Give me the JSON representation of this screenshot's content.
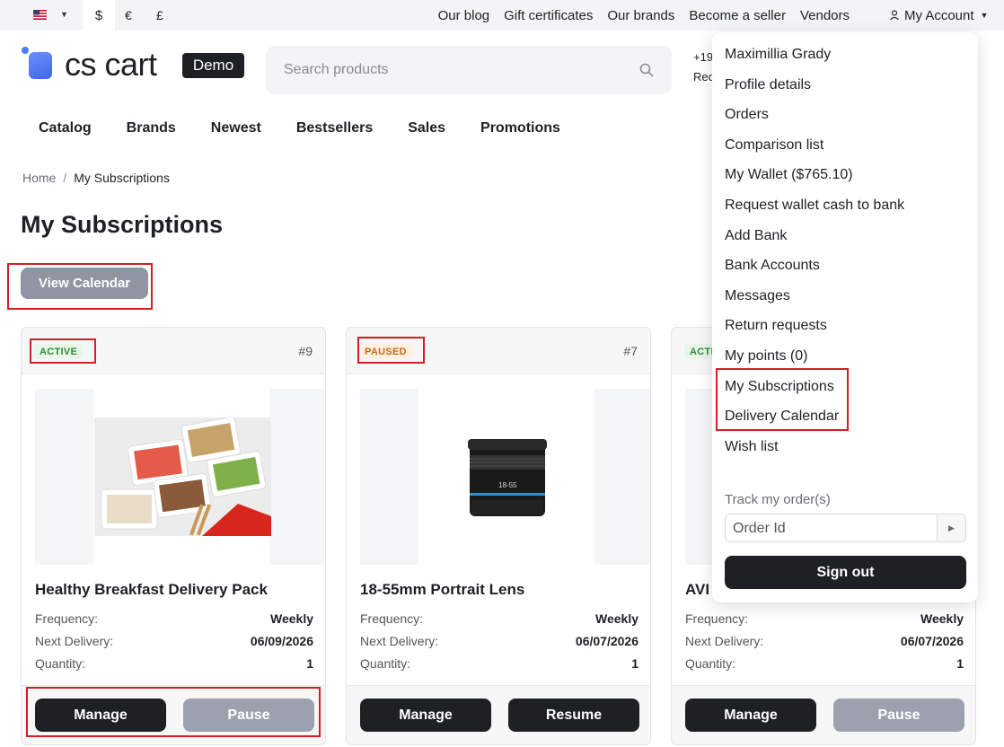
{
  "topbar": {
    "language_flag": "us-flag-icon",
    "currencies": [
      "$",
      "€",
      "£"
    ],
    "links": [
      "Our blog",
      "Gift certificates",
      "Our brands",
      "Become a seller",
      "Vendors"
    ],
    "my_account": "My Account"
  },
  "header": {
    "logo_text": "cs cart",
    "demo_badge": "Demo",
    "search_placeholder": "Search products",
    "phone_partial": "+19",
    "request_partial": "Rec"
  },
  "nav": [
    "Catalog",
    "Brands",
    "Newest",
    "Bestsellers",
    "Sales",
    "Promotions"
  ],
  "breadcrumb": {
    "home": "Home",
    "separator": "/",
    "current": "My Subscriptions"
  },
  "page_title": "My Subscriptions",
  "view_calendar_label": "View Calendar",
  "cards": [
    {
      "status": "ACTIVE",
      "number": "#9",
      "name": "Healthy Breakfast Delivery Pack",
      "frequency_label": "Frequency:",
      "frequency": "Weekly",
      "next_label": "Next Delivery:",
      "next": "06/09/2026",
      "qty_label": "Quantity:",
      "qty": "1",
      "primary": "Manage",
      "secondary": "Pause"
    },
    {
      "status": "PAUSED",
      "number": "#7",
      "name": "18-55mm Portrait Lens",
      "frequency_label": "Frequency:",
      "frequency": "Weekly",
      "next_label": "Next Delivery:",
      "next": "06/07/2026",
      "qty_label": "Quantity:",
      "qty": "1",
      "primary": "Manage",
      "secondary": "Resume"
    },
    {
      "status": "ACTIVE",
      "number": "",
      "name": "AVI",
      "frequency_label": "Frequency:",
      "frequency": "Weekly",
      "next_label": "Next Delivery:",
      "next": "06/07/2026",
      "qty_label": "Quantity:",
      "qty": "1",
      "primary": "Manage",
      "secondary": "Pause"
    }
  ],
  "account_menu": {
    "items": [
      "Maximillia Grady",
      "Profile details",
      "Orders",
      "Comparison list",
      "My Wallet ($765.10)",
      "Request wallet cash to bank",
      "Add Bank",
      "Bank Accounts",
      "Messages",
      "Return requests",
      "My points (0)",
      "My Subscriptions",
      "Delivery Calendar",
      "Wish list"
    ],
    "track_label": "Track my order(s)",
    "order_placeholder": "Order Id",
    "sign_out": "Sign out"
  },
  "colors": {
    "dark": "#1f2024",
    "highlight": "#d51e24",
    "active_badge": "#2f8a3b",
    "paused_badge": "#c76a13"
  }
}
